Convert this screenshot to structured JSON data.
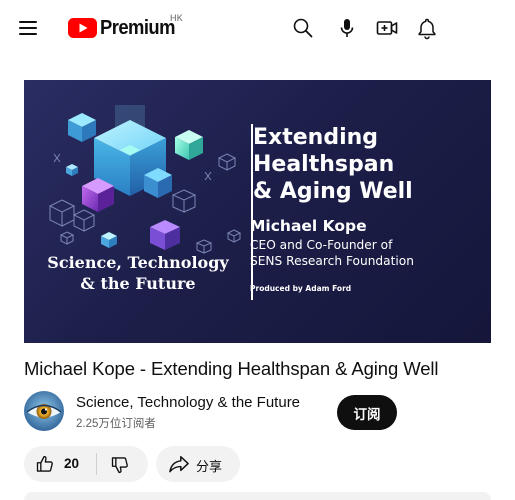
{
  "header": {
    "logo_text": "Premium",
    "region": "HK",
    "menu_icon": "hamburger-menu-icon",
    "search_icon": "search-icon",
    "mic_icon": "microphone-icon",
    "create_icon": "create-video-icon",
    "notifications_icon": "bell-icon",
    "brand_color": "#ff0000"
  },
  "thumbnail": {
    "title_lines": [
      "Extending",
      "Healthspan",
      "& Aging Well"
    ],
    "speaker_name": "Michael Kope",
    "speaker_role_lines": [
      "CEO and Co-Founder of",
      "SENS Research Foundation"
    ],
    "producer": "Produced by Adam Ford",
    "series_lines": [
      "Science, Technology",
      "& the Future"
    ],
    "background_color": "#1f2150",
    "accent_colors": [
      "#6fd3f7",
      "#7be0c8",
      "#a24bd6"
    ]
  },
  "video": {
    "title": "Michael Kope - Extending Healthspan & Aging Well"
  },
  "channel": {
    "name": "Science, Technology & the Future",
    "subscribers": "2.25万位订阅者",
    "subscribe_label": "订阅",
    "avatar_icon": "eye-avatar"
  },
  "actions": {
    "like_count": "20",
    "like_icon": "thumbs-up-icon",
    "dislike_icon": "thumbs-down-icon",
    "share_label": "分享",
    "share_icon": "share-arrow-icon"
  }
}
